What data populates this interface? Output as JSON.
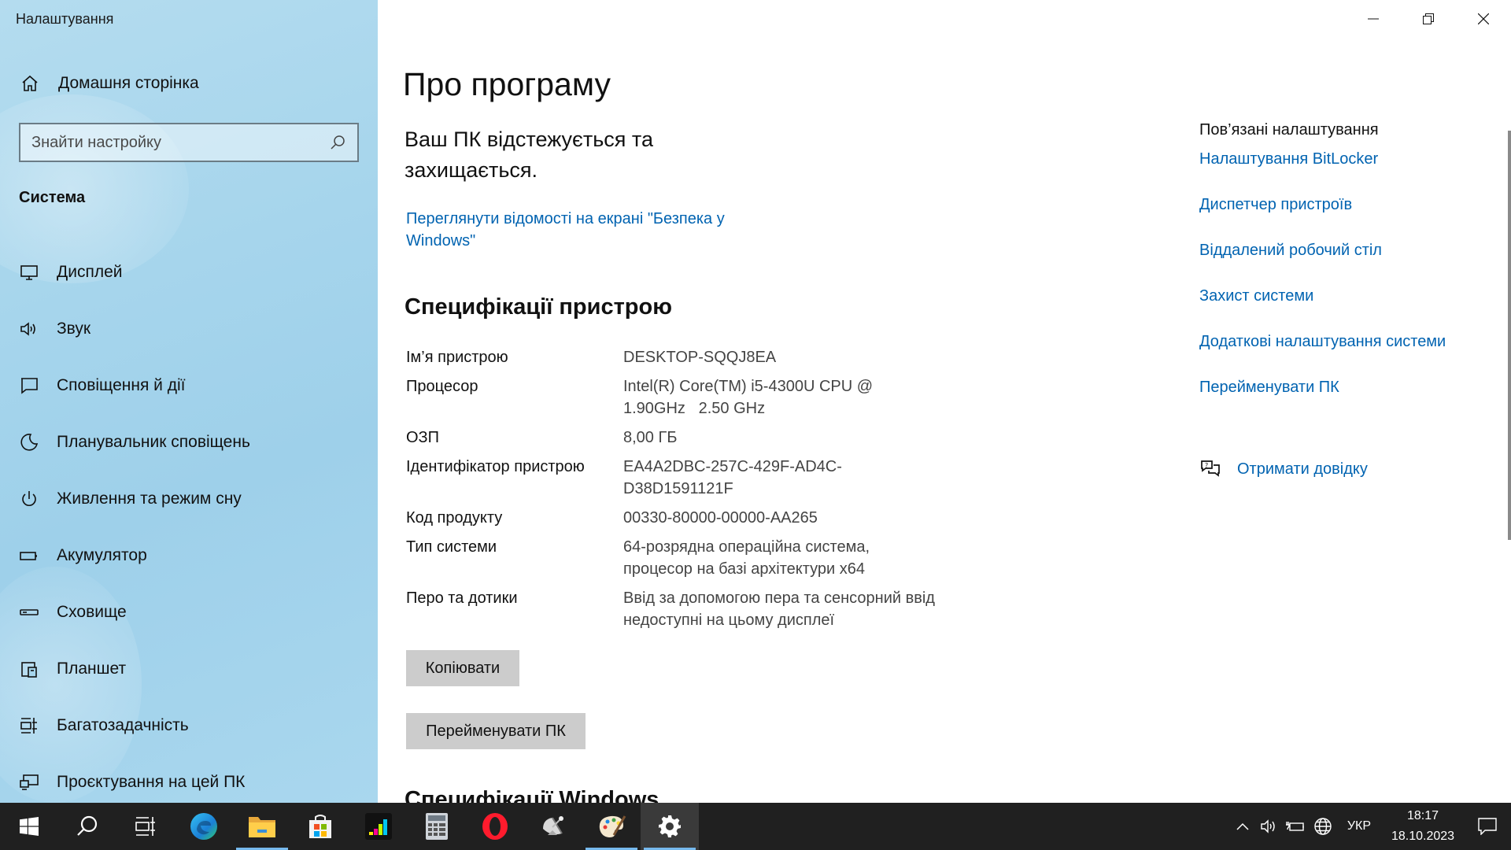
{
  "window": {
    "title": "Налаштування"
  },
  "sidebar": {
    "home_label": "Домашня сторінка",
    "search_placeholder": "Знайти настройку",
    "section_label": "Система",
    "items": [
      {
        "label": "Дисплей",
        "icon": "monitor-icon"
      },
      {
        "label": "Звук",
        "icon": "speaker-icon"
      },
      {
        "label": "Сповіщення й дії",
        "icon": "notification-icon"
      },
      {
        "label": "Планувальник сповіщень",
        "icon": "moon-icon"
      },
      {
        "label": "Живлення та режим сну",
        "icon": "power-icon"
      },
      {
        "label": "Акумулятор",
        "icon": "battery-icon"
      },
      {
        "label": "Сховище",
        "icon": "storage-icon"
      },
      {
        "label": "Планшет",
        "icon": "tablet-icon"
      },
      {
        "label": "Багатозадачність",
        "icon": "multitasking-icon"
      },
      {
        "label": "Проєктування на цей ПК",
        "icon": "projecting-icon"
      }
    ]
  },
  "main": {
    "page_title": "Про програму",
    "protection_text": "Ваш ПК відстежується та захищається.",
    "security_link": "Переглянути відомості на екрані \"Безпека у Windows\"",
    "device_specs_title": "Специфікації пристрою",
    "specs": [
      {
        "key": "Ім’я пристрою",
        "value": "DESKTOP-SQQJ8EA"
      },
      {
        "key": "Процесор",
        "value": "Intel(R) Core(TM) i5-4300U CPU @ 1.90GHz   2.50 GHz"
      },
      {
        "key": "ОЗП",
        "value": "8,00 ГБ"
      },
      {
        "key": "Ідентифікатор пристрою",
        "value": "EA4A2DBC-257C-429F-AD4C-D38D1591121F"
      },
      {
        "key": "Код продукту",
        "value": "00330-80000-00000-AA265"
      },
      {
        "key": "Тип системи",
        "value": "64-розрядна операційна система, процесор на базі архітектури x64"
      },
      {
        "key": "Перо та дотики",
        "value": "Ввід за допомогою пера та сенсорний ввід недоступні на цьому дисплеї"
      }
    ],
    "copy_button": "Копіювати",
    "rename_button": "Перейменувати ПК",
    "windows_specs_title": "Специфікації Windows"
  },
  "related": {
    "title": "Пов’язані налаштування",
    "links": [
      "Налаштування BitLocker",
      "Диспетчер пристроїв",
      "Віддалений робочий стіл",
      "Захист системи",
      "Додаткові налаштування системи",
      "Перейменувати ПК"
    ],
    "help_label": "Отримати довідку"
  },
  "taskbar": {
    "apps": [
      {
        "name": "start-button",
        "icon": "windows-logo-icon"
      },
      {
        "name": "search-button",
        "icon": "search-icon"
      },
      {
        "name": "task-view-button",
        "icon": "task-view-icon"
      },
      {
        "name": "edge-app",
        "icon": "edge-icon"
      },
      {
        "name": "file-explorer-app",
        "icon": "folder-icon"
      },
      {
        "name": "store-app",
        "icon": "store-icon"
      },
      {
        "name": "deezer-app",
        "icon": "equalizer-icon"
      },
      {
        "name": "calculator-app",
        "icon": "calculator-icon"
      },
      {
        "name": "opera-app",
        "icon": "opera-icon"
      },
      {
        "name": "satellite-app",
        "icon": "satellite-icon"
      },
      {
        "name": "paint-app",
        "icon": "palette-icon"
      },
      {
        "name": "settings-app",
        "icon": "gear-icon"
      }
    ],
    "language": "УКР",
    "time": "18:17",
    "date": "18.10.2023"
  },
  "colors": {
    "link": "#0063b1",
    "sidebar_bg": "#a6d5ec",
    "taskbar_bg": "#202020"
  }
}
